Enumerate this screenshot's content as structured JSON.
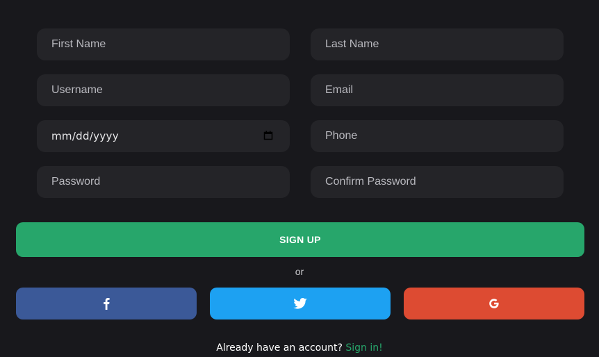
{
  "form": {
    "fields": [
      {
        "name": "first-name",
        "placeholder": "First Name"
      },
      {
        "name": "last-name",
        "placeholder": "Last Name"
      },
      {
        "name": "username",
        "placeholder": "Username"
      },
      {
        "name": "email",
        "placeholder": "Email"
      },
      {
        "name": "date-of-birth",
        "value": "mm/dd/yyyy"
      },
      {
        "name": "phone",
        "placeholder": "Phone"
      },
      {
        "name": "password",
        "placeholder": "Password"
      },
      {
        "name": "confirm-password",
        "placeholder": "Confirm Password"
      }
    ],
    "signup_label": "SIGN UP",
    "or_label": "or"
  },
  "social": {
    "facebook_icon": "facebook-icon",
    "twitter_icon": "twitter-icon",
    "google_icon": "google-icon"
  },
  "footer": {
    "prompt": "Already have an account?",
    "link": "Sign in!"
  },
  "colors": {
    "background": "#18181c",
    "field": "#242428",
    "accent": "#27a66b",
    "facebook": "#3b5998",
    "twitter": "#1da1f2",
    "google": "#dd4b32"
  }
}
